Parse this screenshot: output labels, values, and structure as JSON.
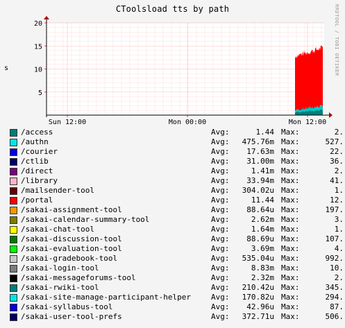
{
  "chart_data": {
    "type": "area",
    "title": "CToolsload tts by path",
    "ylabel": "s",
    "watermark": "RRDTOOL / TOBI OETIKER",
    "ylim": [
      0,
      20
    ],
    "yticks": [
      5,
      10,
      15,
      20
    ],
    "xticks": [
      "Sun 12:00",
      "Mon 00:00",
      "Mon 12:00"
    ],
    "grid": true,
    "series": [
      {
        "name": "/access",
        "color": "#007c7c",
        "avg": "1.44",
        "max": "2."
      },
      {
        "name": "/authn",
        "color": "#00e6e6",
        "avg": "475.76m",
        "max": "527."
      },
      {
        "name": "/courier",
        "color": "#0000e6",
        "avg": "17.63m",
        "max": "22."
      },
      {
        "name": "/ctlib",
        "color": "#000064",
        "avg": "31.00m",
        "max": "36."
      },
      {
        "name": "/direct",
        "color": "#7c007c",
        "avg": "1.41m",
        "max": "2."
      },
      {
        "name": "/library",
        "color": "#ffb4c8",
        "avg": "33.94m",
        "max": "41."
      },
      {
        "name": "/mailsender-tool",
        "color": "#640000",
        "avg": "304.02u",
        "max": "1."
      },
      {
        "name": "/portal",
        "color": "#ff0000",
        "avg": "11.44",
        "max": "12."
      },
      {
        "name": "/sakai-assignment-tool",
        "color": "#ff9600",
        "avg": "88.64u",
        "max": "197."
      },
      {
        "name": "/sakai-calendar-summary-tool",
        "color": "#7c7c00",
        "avg": "2.62m",
        "max": "3."
      },
      {
        "name": "/sakai-chat-tool",
        "color": "#ffff00",
        "avg": "1.64m",
        "max": "1."
      },
      {
        "name": "/sakai-discussion-tool",
        "color": "#007c00",
        "avg": "88.69u",
        "max": "107."
      },
      {
        "name": "/sakai-evaluation-tool",
        "color": "#00ff00",
        "avg": "3.69m",
        "max": "4."
      },
      {
        "name": "/sakai-gradebook-tool",
        "color": "#c8c8c8",
        "avg": "535.04u",
        "max": "992."
      },
      {
        "name": "/sakai-login-tool",
        "color": "#7c7c7c",
        "avg": "8.83m",
        "max": "10."
      },
      {
        "name": "/sakai-messageforums-tool",
        "color": "#000000",
        "avg": "2.32m",
        "max": "2."
      },
      {
        "name": "/sakai-rwiki-tool",
        "color": "#007c7c",
        "avg": "210.42u",
        "max": "345."
      },
      {
        "name": "/sakai-site-manage-participant-helper",
        "color": "#00e6e6",
        "avg": "170.82u",
        "max": "294."
      },
      {
        "name": "/sakai-syllabus-tool",
        "color": "#0000e6",
        "avg": "42.96u",
        "max": "87."
      },
      {
        "name": "/sakai-user-tool-prefs",
        "color": "#000064",
        "avg": "372.71u",
        "max": "506."
      }
    ],
    "avg_label": "Avg:",
    "max_label": "Max:"
  }
}
